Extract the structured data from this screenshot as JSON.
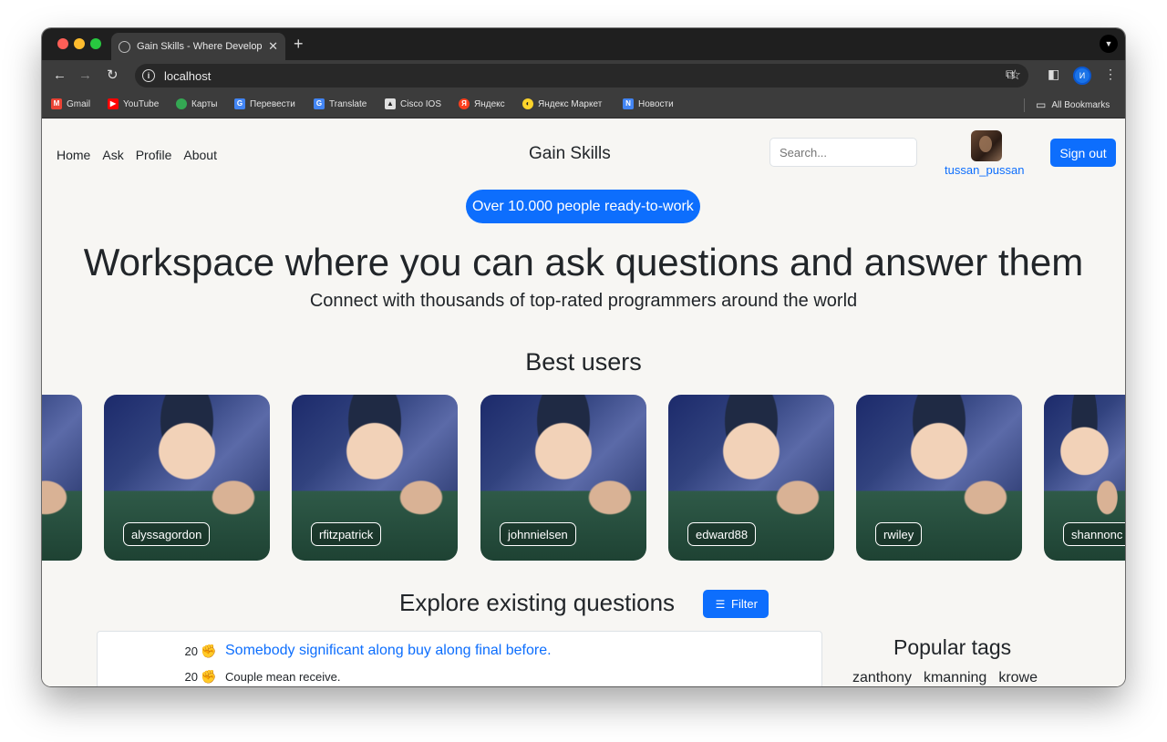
{
  "browser": {
    "tab_title": "Gain Skills - Where Developers",
    "tab_close": "✕",
    "new_tab": "+",
    "url": "localhost",
    "profile_initial": "И",
    "bookmarks": [
      {
        "label": "Gmail",
        "color": "#ea4335",
        "glyph": "M"
      },
      {
        "label": "YouTube",
        "color": "#ff0000",
        "glyph": "▶"
      },
      {
        "label": "Карты",
        "color": "#34a853",
        "glyph": "◉"
      },
      {
        "label": "Перевести",
        "color": "#4285f4",
        "glyph": "G"
      },
      {
        "label": "Translate",
        "color": "#4285f4",
        "glyph": "G"
      },
      {
        "label": "Cisco IOS",
        "color": "#e0e0e0",
        "glyph": "▲"
      },
      {
        "label": "Яндекс",
        "color": "#fc3f1d",
        "glyph": "Я"
      },
      {
        "label": "Яндекс Маркет",
        "color": "#fed42b",
        "glyph": "◐"
      },
      {
        "label": "Новости",
        "color": "#4285f4",
        "glyph": "N"
      }
    ],
    "all_bookmarks": "All Bookmarks"
  },
  "nav": {
    "links": [
      "Home",
      "Ask",
      "Profile",
      "About"
    ],
    "brand": "Gain Skills",
    "search_placeholder": "Search...",
    "username": "tussan_pussan",
    "signout": "Sign out"
  },
  "hero": {
    "pill": "Over 10.000 people ready-to-work",
    "title": "Workspace where you can ask questions and answer them",
    "subtitle": "Connect with thousands of top-rated programmers around the world"
  },
  "best_users": {
    "title": "Best users",
    "users": [
      "alyssagordon",
      "rfitzpatrick",
      "johnnielsen",
      "edward88",
      "rwiley",
      "shannonc"
    ]
  },
  "explore": {
    "title": "Explore existing questions",
    "filter_label": "Filter",
    "questions": [
      {
        "votes": "20",
        "title": "Somebody significant along buy along final before.",
        "icon_color": "#3fa9d6"
      },
      {
        "votes": "20",
        "title": "Couple mean receive.",
        "icon_color": "#e0484f"
      }
    ]
  },
  "popular_tags": {
    "title": "Popular tags",
    "tags": [
      "zanthony",
      "kmanning",
      "krowe"
    ]
  }
}
